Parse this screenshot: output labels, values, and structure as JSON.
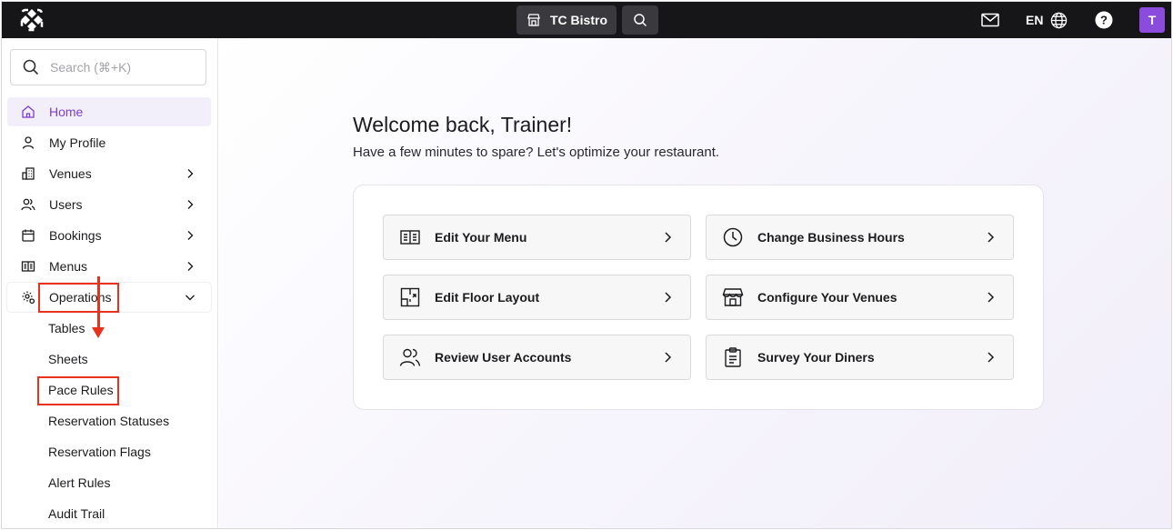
{
  "topbar": {
    "venue_name": "TC Bistro",
    "language": "EN",
    "avatar_initial": "T"
  },
  "sidebar": {
    "search_placeholder": "Search (⌘+K)",
    "items": [
      {
        "label": "Home",
        "icon": "home-icon",
        "active": true
      },
      {
        "label": "My Profile",
        "icon": "user-icon"
      },
      {
        "label": "Venues",
        "icon": "building-icon",
        "chevron": "right"
      },
      {
        "label": "Users",
        "icon": "users-icon",
        "chevron": "right"
      },
      {
        "label": "Bookings",
        "icon": "calendar-icon",
        "chevron": "right"
      },
      {
        "label": "Menus",
        "icon": "menu-book-icon",
        "chevron": "right"
      },
      {
        "label": "Operations",
        "icon": "gear-icon",
        "chevron": "down"
      }
    ],
    "operations_subitems": [
      "Tables",
      "Sheets",
      "Pace Rules",
      "Reservation Statuses",
      "Reservation Flags",
      "Alert Rules",
      "Audit Trail"
    ]
  },
  "main": {
    "welcome": "Welcome back, Trainer!",
    "subtitle": "Have a few minutes to spare? Let's optimize your restaurant.",
    "actions": [
      {
        "label": "Edit Your Menu",
        "icon": "menu-book-icon"
      },
      {
        "label": "Change Business Hours",
        "icon": "clock-icon"
      },
      {
        "label": "Edit Floor Layout",
        "icon": "floor-plan-icon"
      },
      {
        "label": "Configure Your Venues",
        "icon": "storefront-icon"
      },
      {
        "label": "Review User Accounts",
        "icon": "users-icon"
      },
      {
        "label": "Survey Your Diners",
        "icon": "clipboard-icon"
      }
    ]
  },
  "colors": {
    "topbar": "#161618",
    "accent": "#7b3fd1",
    "avatar": "#8b4bdc",
    "callout": "#e8321e"
  }
}
